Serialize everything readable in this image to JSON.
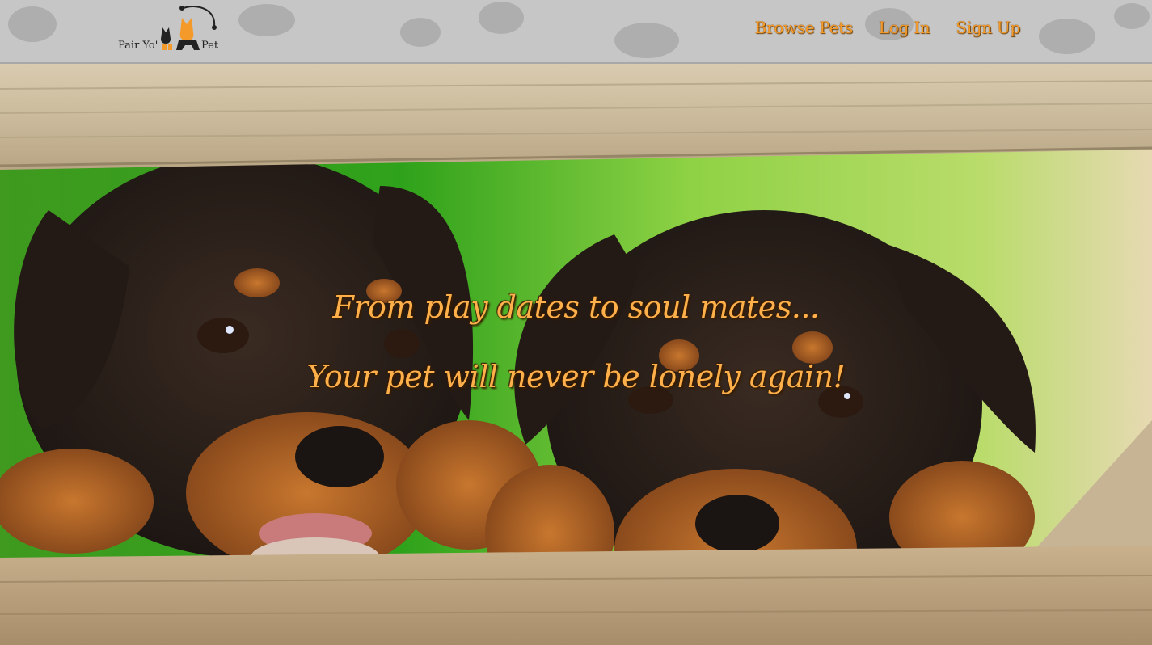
{
  "brand": {
    "logo_left_text": "Pair Yo'",
    "logo_right_text": "Pet",
    "accent_color": "#f39a2b"
  },
  "nav": {
    "links": [
      {
        "label": "Browse Pets"
      },
      {
        "label": "Log In"
      },
      {
        "label": "Sign Up"
      }
    ]
  },
  "hero": {
    "line1": "From play dates to soul mates...",
    "line2": "Your pet will never be lonely again!",
    "image": "two-rottweiler-puppies-behind-wooden-fence"
  }
}
